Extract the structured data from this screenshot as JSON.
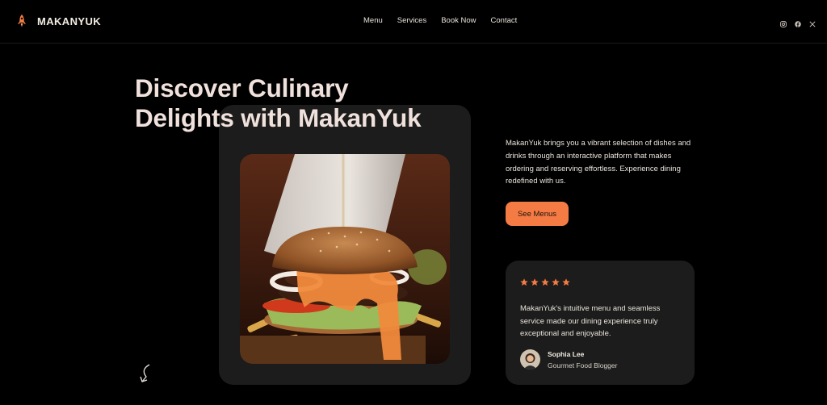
{
  "brand": {
    "name": "MAKANYUK"
  },
  "nav": {
    "items": [
      "Menu",
      "Services",
      "Book Now",
      "Contact"
    ]
  },
  "social": [
    "instagram-icon",
    "facebook-icon",
    "x-icon"
  ],
  "hero": {
    "headline_line1": "Discover Culinary",
    "headline_line2": "Delights with MakanYuk",
    "description": "MakanYuk brings you a vibrant selection of dishes and drinks through an interactive platform that makes ordering and reserving effortless. Experience dining redefined with us.",
    "cta_label": "See Menus"
  },
  "testimonial": {
    "rating": 5,
    "quote": "MakanYuk's intuitive menu and seamless service made our dining experience truly exceptional and enjoyable.",
    "author_name": "Sophia Lee",
    "author_role": "Gourmet Food Blogger"
  },
  "colors": {
    "accent": "#f57b44",
    "background": "#000000",
    "card": "#1b1c1b",
    "headline": "#f0e1dc"
  }
}
